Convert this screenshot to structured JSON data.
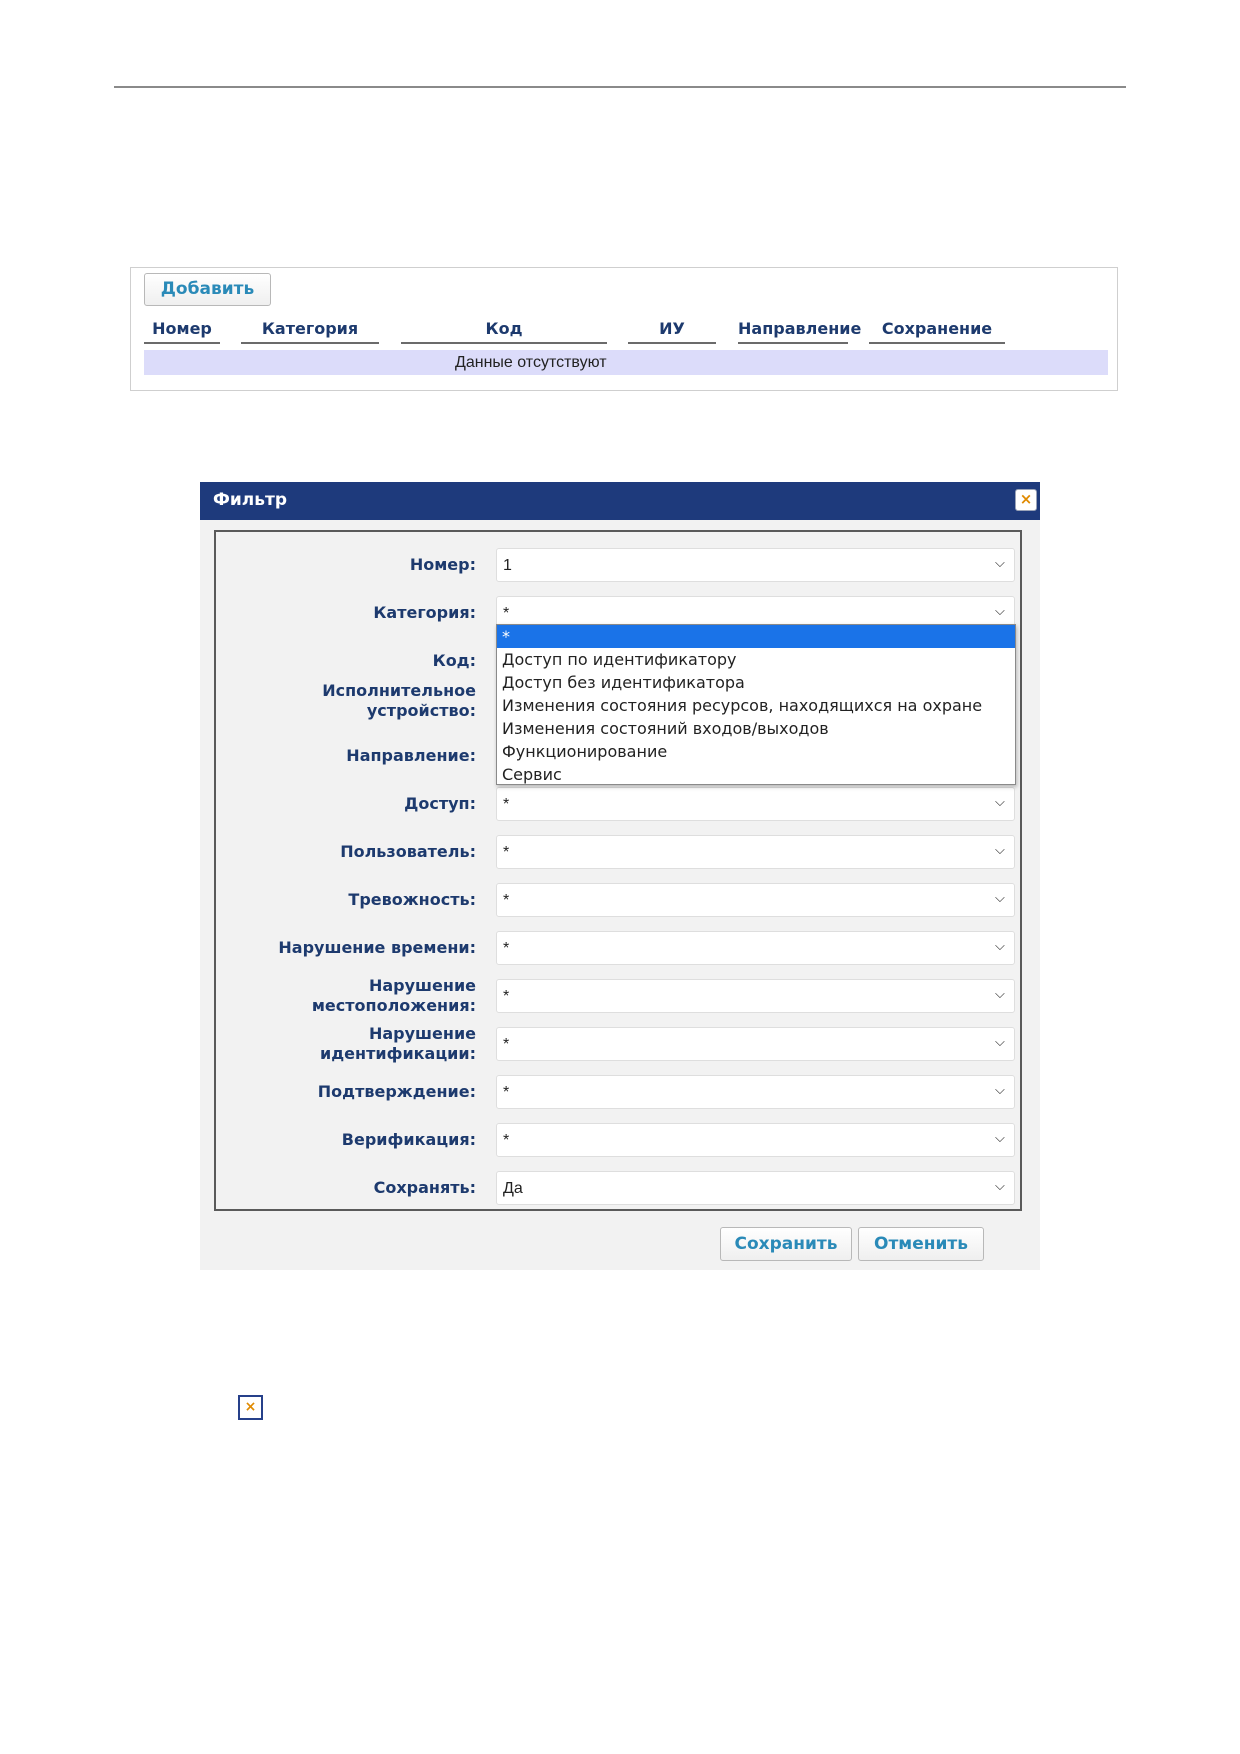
{
  "events_panel": {
    "add_label": "Добавить",
    "columns": [
      "Номер",
      "Категория",
      "Код",
      "ИУ",
      "Направление",
      "Сохранение"
    ],
    "empty_text": "Данные отсутствуют"
  },
  "filter_dialog": {
    "title": "Фильтр",
    "close_glyph": "×",
    "fields": [
      {
        "label": "Номер:",
        "value": "1"
      },
      {
        "label": "Категория:",
        "value": "*"
      },
      {
        "label": "Код:",
        "value": ""
      },
      {
        "label": "Исполнительное устройство:",
        "value": ""
      },
      {
        "label": "Направление:",
        "value": ""
      },
      {
        "label": "Доступ:",
        "value": "*"
      },
      {
        "label": "Пользователь:",
        "value": "*"
      },
      {
        "label": "Тревожность:",
        "value": "*"
      },
      {
        "label": "Нарушение времени:",
        "value": "*"
      },
      {
        "label": "Нарушение местоположения:",
        "value": "*"
      },
      {
        "label": "Нарушение идентификации:",
        "value": "*"
      },
      {
        "label": "Подтверждение:",
        "value": "*"
      },
      {
        "label": "Верификация:",
        "value": "*"
      },
      {
        "label": "Сохранять:",
        "value": "Да"
      }
    ],
    "category_options": [
      "*",
      "Доступ по идентификатору",
      "Доступ без идентификатора",
      "Изменения состояния ресурсов, находящихся на охране",
      "Изменения состояний входов/выходов",
      "Функционирование",
      "Сервис"
    ],
    "selected_option_index": 0,
    "save_label": "Сохранить",
    "cancel_label": "Отменить"
  },
  "close_icon_glyph": "×"
}
